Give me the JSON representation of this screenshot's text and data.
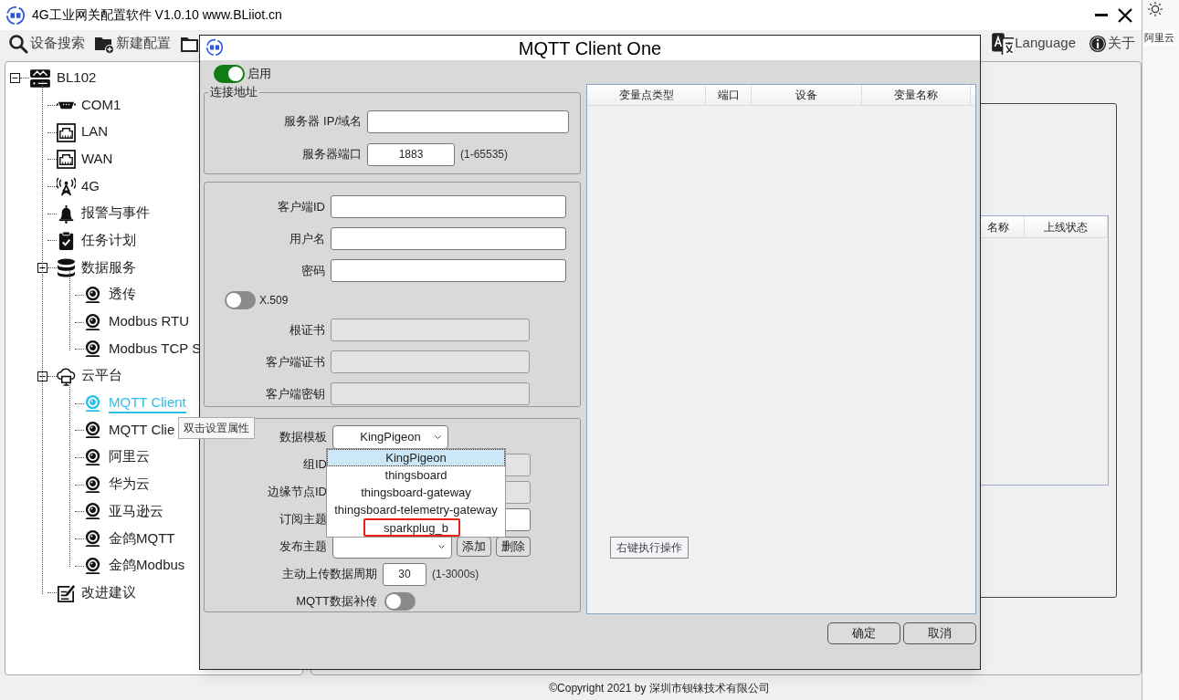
{
  "app": {
    "title": "4G工业网关配置软件 V1.0.10 www.BLiiot.cn"
  },
  "toolbar": [
    {
      "label": "设备搜索",
      "kind": "search"
    },
    {
      "label": "新建配置",
      "kind": "folder-plus"
    },
    {
      "kind": "folder"
    }
  ],
  "toolbar_right": [
    {
      "label": "Language",
      "kind": "translate"
    },
    {
      "label": "关于",
      "kind": "info"
    }
  ],
  "tree": [
    {
      "label": "BL102",
      "kind": "router",
      "expanded": true,
      "selected": false,
      "children": [
        {
          "label": "COM1",
          "kind": "serial",
          "selected": false
        },
        {
          "label": "LAN",
          "kind": "ethernet",
          "selected": false
        },
        {
          "label": "WAN",
          "kind": "ethernet",
          "selected": false
        },
        {
          "label": "4G",
          "kind": "antenna",
          "selected": false
        },
        {
          "label": "报警与事件",
          "kind": "bell",
          "selected": false
        },
        {
          "label": "任务计划",
          "kind": "clipboard",
          "selected": false
        },
        {
          "label": "数据服务",
          "kind": "database",
          "expanded": true,
          "selected": false,
          "children": [
            {
              "label": "透传",
              "kind": "camera",
              "selected": false
            },
            {
              "label": "Modbus RTU",
              "kind": "camera",
              "selected": false
            },
            {
              "label": "Modbus TCP S",
              "kind": "camera",
              "selected": false
            }
          ]
        },
        {
          "label": "云平台",
          "kind": "cloud",
          "expanded": true,
          "selected": false,
          "children": [
            {
              "label": "MQTT Client",
              "kind": "camera",
              "selected": true
            },
            {
              "label": "MQTT Clie",
              "kind": "camera",
              "selected": false
            },
            {
              "label": "阿里云",
              "kind": "camera",
              "selected": false
            },
            {
              "label": "华为云",
              "kind": "camera",
              "selected": false
            },
            {
              "label": "亚马逊云",
              "kind": "camera",
              "selected": false
            },
            {
              "label": "金鸽MQTT",
              "kind": "camera",
              "selected": false
            },
            {
              "label": "金鸽Modbus",
              "kind": "camera",
              "selected": false
            }
          ]
        },
        {
          "label": "改进建议",
          "kind": "note",
          "selected": false
        }
      ]
    }
  ],
  "tooltip": "双击设置属性",
  "device_table": {
    "columns": [
      "名称",
      "上线状态"
    ]
  },
  "footer": "©Copyright 2021 by 深圳市钡铼技术有限公司",
  "browser_edge": {
    "text": "阿里云"
  },
  "dialog": {
    "title": "MQTT Client One",
    "enable": {
      "label": "启用",
      "on": true
    },
    "groups": [
      {
        "title": "连接地址",
        "fields": [
          {
            "kind": "text",
            "label": "服务器 IP/域名",
            "disabled": false
          },
          {
            "kind": "number",
            "label": "服务器端口",
            "value": "1883",
            "suffix": "(1-65535)",
            "disabled": false
          }
        ]
      },
      {
        "fields": [
          {
            "kind": "text",
            "label": "客户端ID",
            "disabled": false
          },
          {
            "kind": "text",
            "label": "用户名",
            "disabled": false
          },
          {
            "kind": "text",
            "label": "密码",
            "disabled": false
          },
          {
            "kind": "switch",
            "label": "X.509",
            "on": false
          },
          {
            "kind": "text",
            "label": "根证书",
            "disabled": true
          },
          {
            "kind": "text",
            "label": "客户端证书",
            "disabled": true
          },
          {
            "kind": "text",
            "label": "客户端密钥",
            "disabled": true
          }
        ]
      },
      {
        "fields": [
          {
            "kind": "select",
            "label": "数据模板",
            "value": "KingPigeon",
            "open": true,
            "options": [
              {
                "label": "KingPigeon",
                "selected": true,
                "highlighted": false
              },
              {
                "label": "thingsboard",
                "selected": false,
                "highlighted": false
              },
              {
                "label": "thingsboard-gateway",
                "selected": false,
                "highlighted": false
              },
              {
                "label": "thingsboard-telemetry-gateway",
                "selected": false,
                "highlighted": false
              },
              {
                "label": "sparkplug_b",
                "selected": false,
                "highlighted": true
              }
            ]
          },
          {
            "kind": "text",
            "label": "组ID",
            "disabled": true
          },
          {
            "kind": "text",
            "label": "边缘节点ID",
            "disabled": true
          },
          {
            "kind": "text",
            "label": "订阅主题",
            "disabled": false
          },
          {
            "kind": "select",
            "label": "发布主题",
            "open": false,
            "actions": [
              "添加",
              "删除"
            ]
          },
          {
            "kind": "number",
            "label": "主动上传数据周期",
            "value": "30",
            "suffix": "(1-3000s)",
            "disabled": false
          },
          {
            "kind": "toggle",
            "label": "MQTT数据补传",
            "on": false
          }
        ]
      }
    ],
    "table": {
      "columns": [
        "变量点类型",
        "端口",
        "设备",
        "变量名称"
      ],
      "hint": "右键执行操作"
    },
    "buttons": [
      "确定",
      "取消"
    ]
  }
}
